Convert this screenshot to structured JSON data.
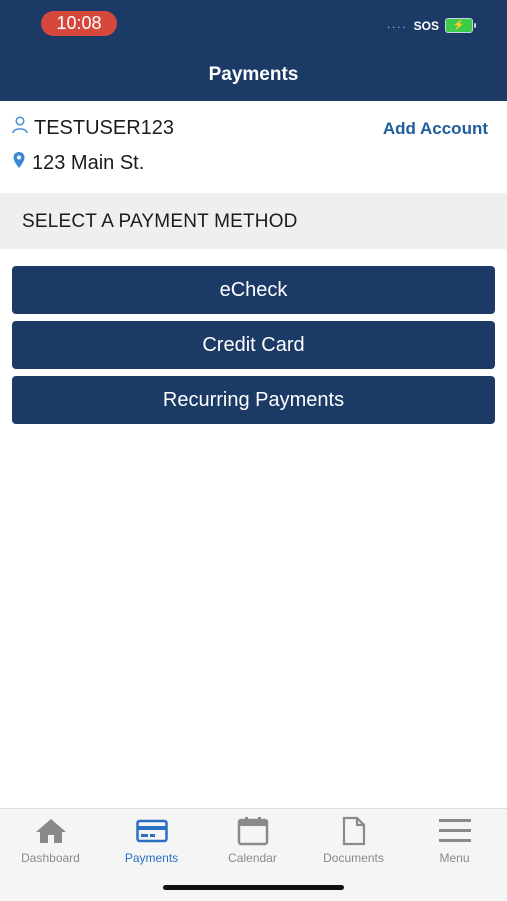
{
  "status_bar": {
    "time": "10:08",
    "carrier": "SOS",
    "signal": "....",
    "battery_icon": "battery-charging-icon"
  },
  "header": {
    "title": "Payments"
  },
  "account": {
    "user_icon": "user-icon",
    "username": "TESTUSER123",
    "location_icon": "location-pin-icon",
    "address": "123 Main St.",
    "add_account_label": "Add Account"
  },
  "section": {
    "title": "SELECT A PAYMENT METHOD"
  },
  "payment_methods": [
    {
      "label": "eCheck"
    },
    {
      "label": "Credit Card"
    },
    {
      "label": "Recurring Payments"
    }
  ],
  "tabs": [
    {
      "label": "Dashboard",
      "icon": "home-icon",
      "active": false
    },
    {
      "label": "Payments",
      "icon": "credit-card-icon",
      "active": true
    },
    {
      "label": "Calendar",
      "icon": "calendar-icon",
      "active": false
    },
    {
      "label": "Documents",
      "icon": "document-icon",
      "active": false
    },
    {
      "label": "Menu",
      "icon": "menu-icon",
      "active": false
    }
  ],
  "colors": {
    "primary": "#1b3a66",
    "accent": "#2a6fc4",
    "time_pill": "#d6483c",
    "inactive": "#8a8a8a"
  }
}
